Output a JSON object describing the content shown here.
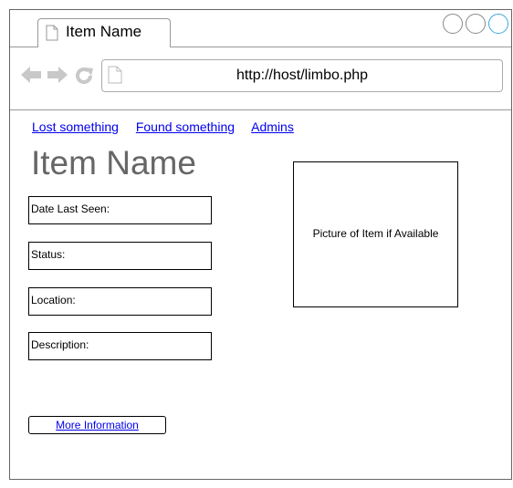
{
  "browser": {
    "tab_title": "Item Name",
    "url": "http://host/limbo.php",
    "accent_color": "#3aa7e0"
  },
  "icons": {
    "window_controls": [
      "circle-icon",
      "circle-icon",
      "circle-icon"
    ],
    "back": "back-arrow-icon",
    "forward": "forward-arrow-icon",
    "reload": "reload-icon",
    "page": "page-icon"
  },
  "nav": {
    "links": [
      "Lost something",
      "Found something",
      "Admins"
    ]
  },
  "item": {
    "title": "Item Name",
    "fields": [
      "Date Last Seen:",
      "Status:",
      "Location:",
      "Description:"
    ],
    "picture_placeholder": "Picture of Item if Available",
    "more_info_label": "More Information"
  }
}
